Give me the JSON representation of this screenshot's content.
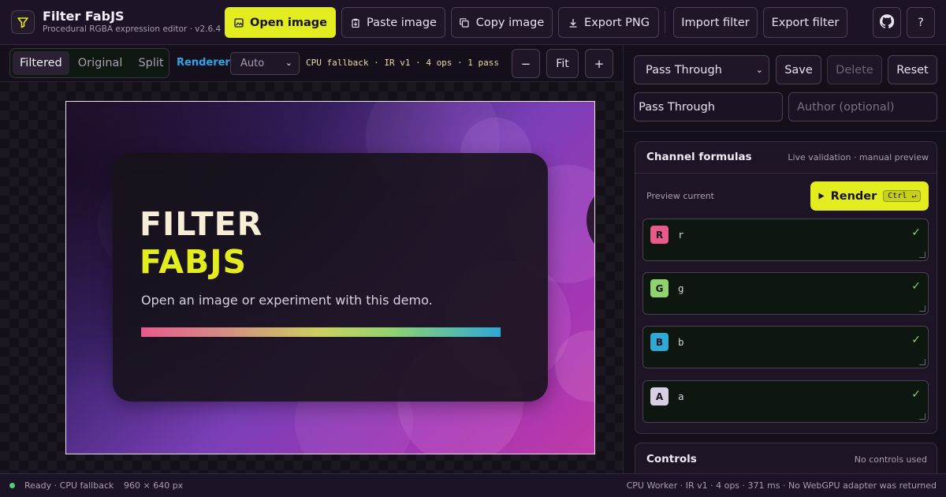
{
  "app": {
    "title": "Filter FabJS",
    "subtitle": "Procedural RGBA expression editor · v2.6.4"
  },
  "header": {
    "open_image": "Open image",
    "paste_image": "Paste image",
    "copy_image": "Copy image",
    "export_png": "Export PNG",
    "import_filter": "Import filter",
    "export_filter": "Export filter",
    "help": "?"
  },
  "view_modes": [
    {
      "label": "Filtered",
      "active": true
    },
    {
      "label": "Original",
      "active": false
    },
    {
      "label": "Split",
      "active": false
    }
  ],
  "toolbar": {
    "renderer_label": "Renderer",
    "renderer_value": "Auto",
    "pipeline_info": "CPU fallback · IR v1 · 4 ops · 1 pass",
    "zoom_out": "−",
    "fit": "Fit",
    "zoom_in": "+"
  },
  "demo": {
    "line1": "FILTER",
    "line2": "FABJS",
    "subtitle": "Open an image or experiment with this demo."
  },
  "presets": {
    "selected": "Pass Through",
    "save": "Save",
    "delete": "Delete",
    "reset": "Reset",
    "name_value": "Pass Through",
    "author_placeholder": "Author (optional)"
  },
  "channels": {
    "title": "Channel formulas",
    "note": "Live validation · manual preview",
    "preview_status": "Preview current",
    "render_label": "Render",
    "render_shortcut": "Ctrl ↵",
    "items": [
      {
        "channel": "R",
        "formula": "r",
        "color": "#e85a8c",
        "valid": "✓"
      },
      {
        "channel": "G",
        "formula": "g",
        "color": "#8fd36f",
        "valid": "✓"
      },
      {
        "channel": "B",
        "formula": "b",
        "color": "#2fa8d6",
        "valid": "✓"
      },
      {
        "channel": "A",
        "formula": "a",
        "color": "#d8cfe4",
        "valid": "✓"
      }
    ]
  },
  "controls": {
    "title": "Controls",
    "note": "No controls used"
  },
  "status": {
    "left": "Ready · CPU fallback",
    "size": "960 × 640 px",
    "right": "CPU Worker · IR v1 · 4 ops · 371 ms · No WebGPU adapter was returned"
  },
  "colors": {
    "accent": "#e2ec1e",
    "renderer_label": "#2ea6e6",
    "background": "#150f1c"
  },
  "icons": [
    "filter-logo-icon",
    "image-icon",
    "paste-icon",
    "copy-icon",
    "download-icon",
    "github-icon",
    "play-icon",
    "check-icon"
  ]
}
